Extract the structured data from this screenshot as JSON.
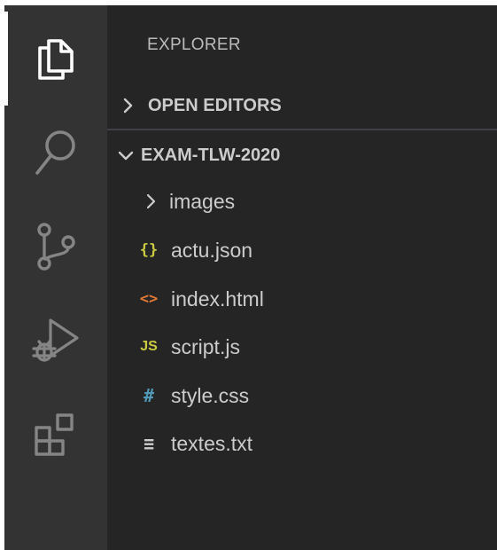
{
  "colors": {
    "activity_bg": "#333333",
    "sidebar_bg": "#252526",
    "text": "#cccccc",
    "json_icon": "#cbcb41",
    "html_icon": "#e37933",
    "js_icon": "#cbcb41",
    "css_icon": "#519aba",
    "txt_icon": "#cccccc"
  },
  "activity_bar": {
    "items": [
      {
        "icon": "explorer-icon",
        "active": true
      },
      {
        "icon": "search-icon",
        "active": false
      },
      {
        "icon": "source-control-icon",
        "active": false
      },
      {
        "icon": "run-debug-icon",
        "active": false
      },
      {
        "icon": "extensions-icon",
        "active": false
      }
    ]
  },
  "sidebar": {
    "title": "EXPLORER",
    "open_editors": {
      "label": "OPEN EDITORS",
      "expanded": false
    },
    "workspace": {
      "label": "EXAM-TLW-2020",
      "expanded": true,
      "items": [
        {
          "name": "images",
          "type": "folder",
          "icon_glyph": "›"
        },
        {
          "name": "actu.json",
          "type": "json",
          "icon_glyph": "{}"
        },
        {
          "name": "index.html",
          "type": "html",
          "icon_glyph": "<>"
        },
        {
          "name": "script.js",
          "type": "js",
          "icon_glyph": "JS"
        },
        {
          "name": "style.css",
          "type": "css",
          "icon_glyph": "#"
        },
        {
          "name": "textes.txt",
          "type": "txt",
          "icon_glyph": "≡"
        }
      ]
    }
  }
}
